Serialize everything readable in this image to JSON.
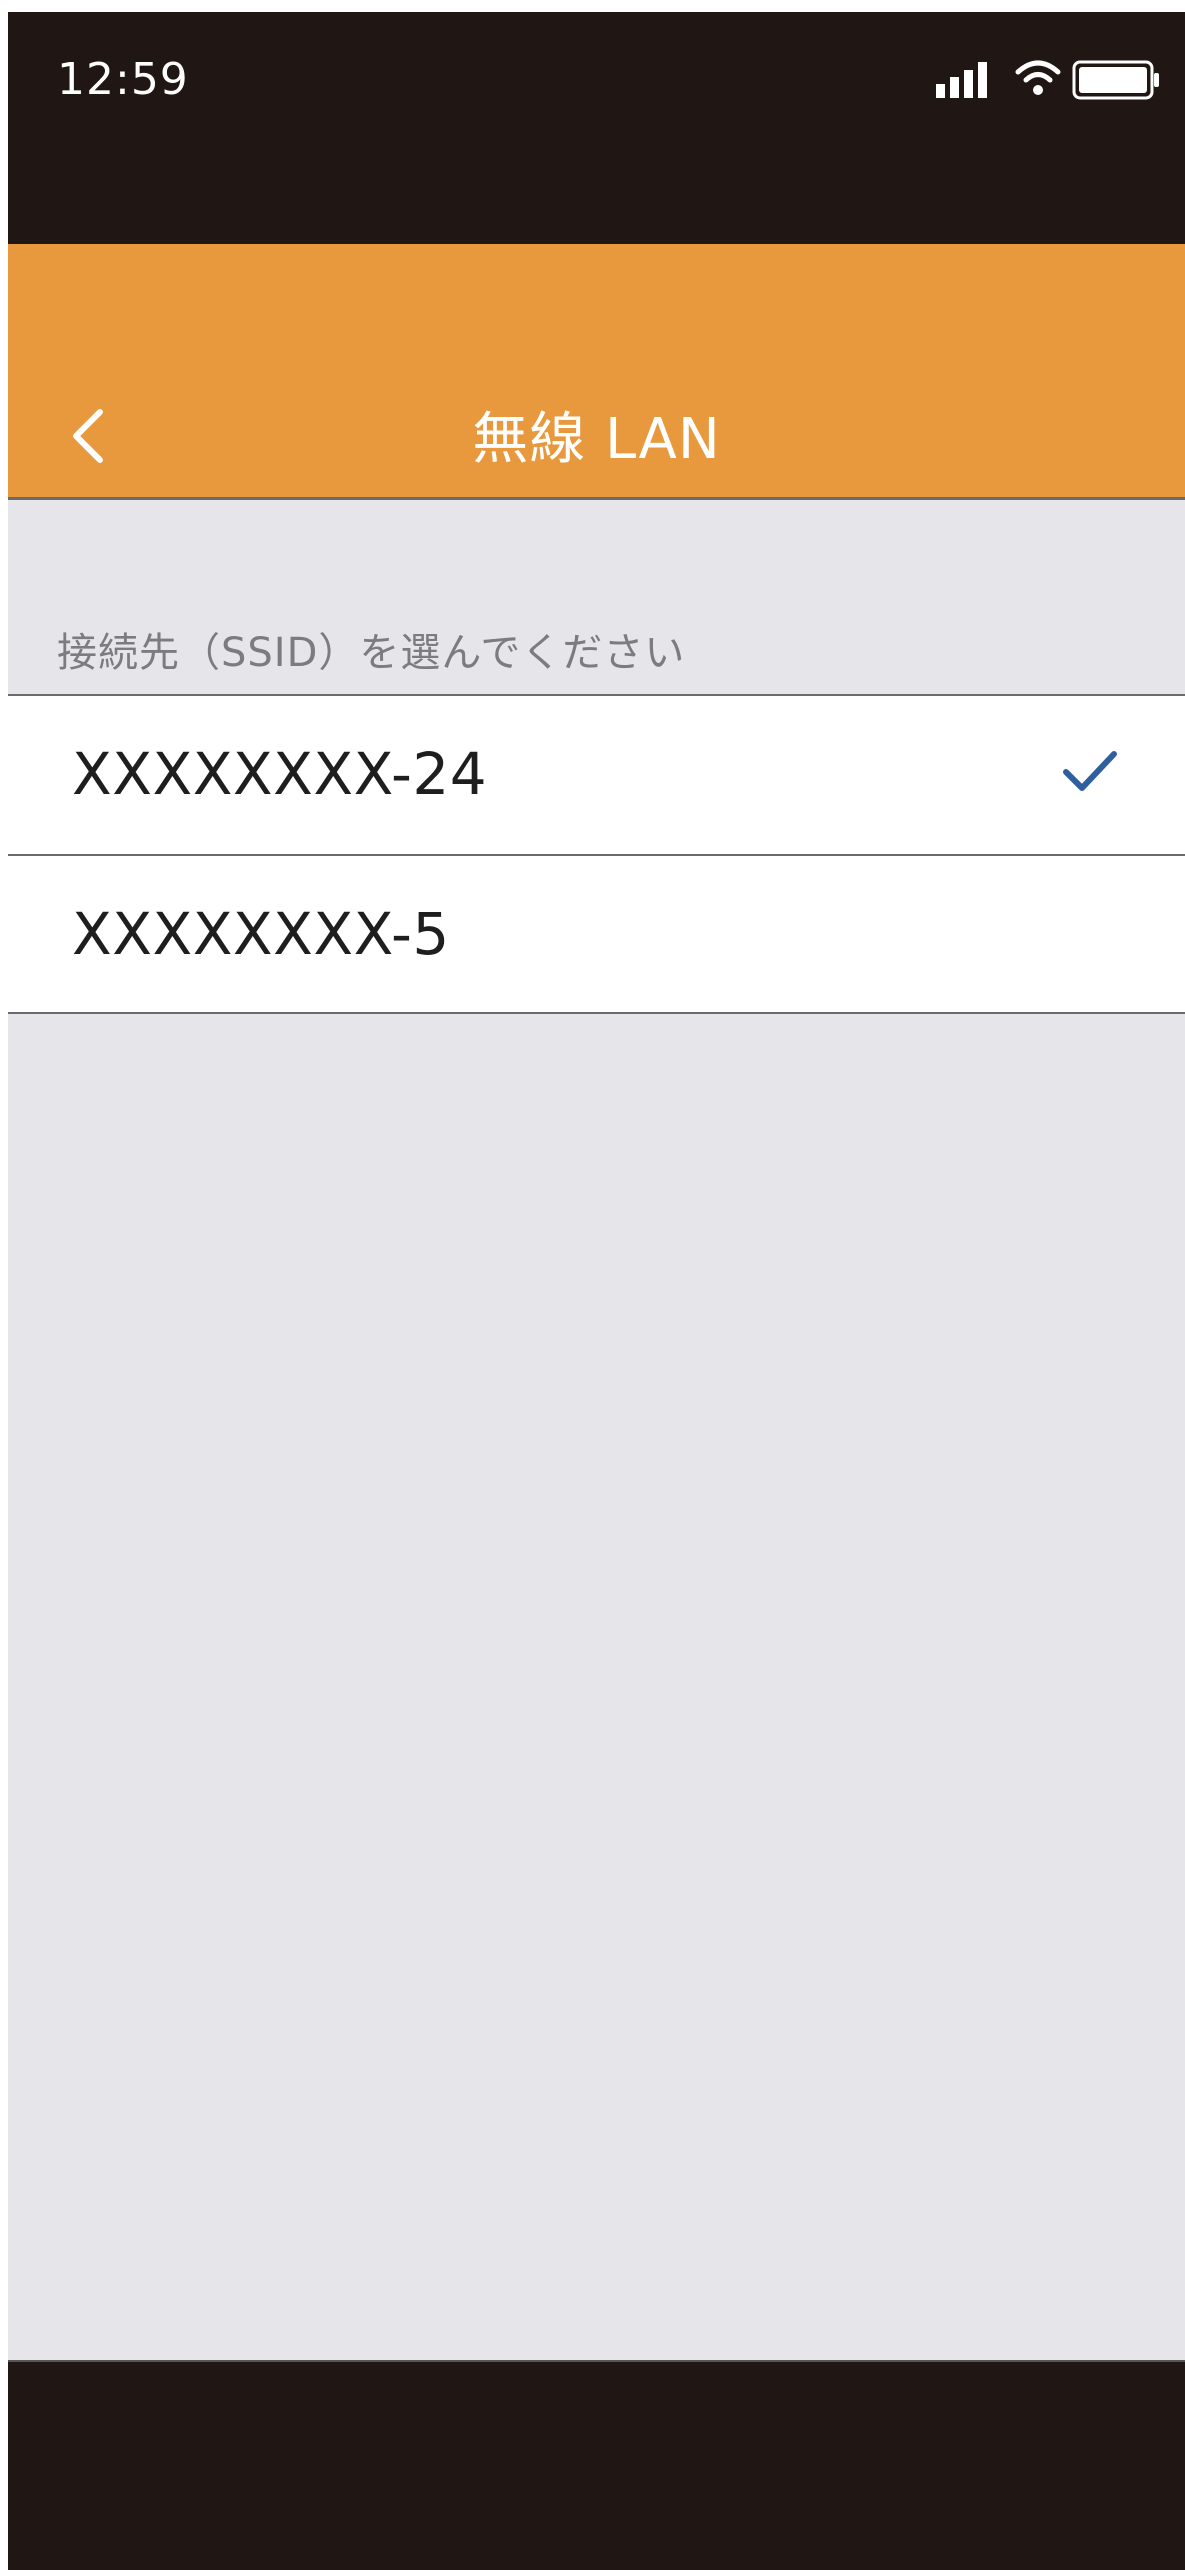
{
  "status_bar": {
    "time": "12:59",
    "signal_icon": "cellular-signal-icon",
    "wifi_icon": "wifi-icon",
    "battery_icon": "battery-full-icon"
  },
  "nav": {
    "back_icon": "chevron-left-icon",
    "title": "無線 LAN"
  },
  "section": {
    "label": "接続先（SSID）を選んでください"
  },
  "ssid_list": [
    {
      "name": "XXXXXXXX-24",
      "selected": true
    },
    {
      "name": "XXXXXXXX-5",
      "selected": false
    }
  ],
  "colors": {
    "header_bg": "#e8993d",
    "status_bg": "#201613",
    "list_bg": "#e6e5ea",
    "check_color": "#2f5f9e"
  }
}
